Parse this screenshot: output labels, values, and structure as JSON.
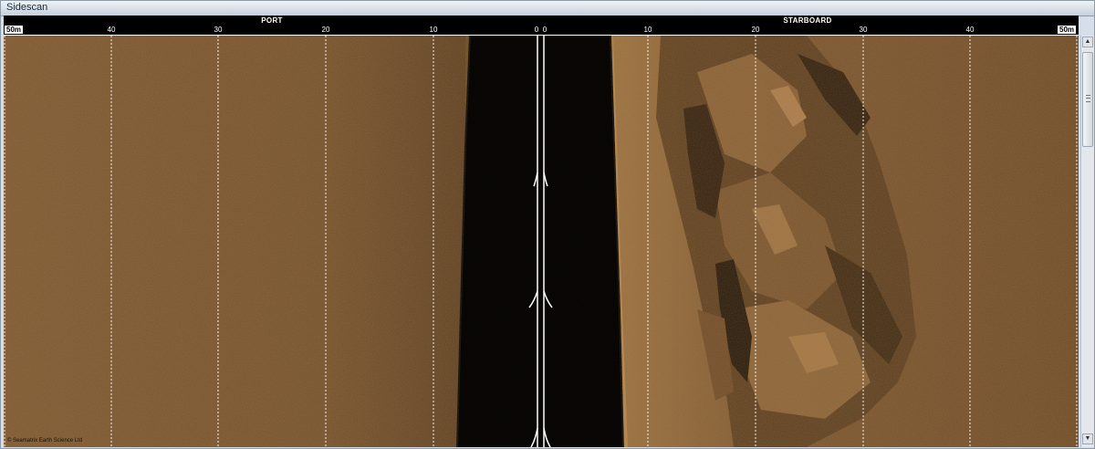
{
  "window": {
    "title": "Sidescan"
  },
  "header": {
    "port_label": "PORT",
    "starboard_label": "STARBOARD",
    "range_left": "50m",
    "range_right": "50m",
    "port_ticks": [
      "40",
      "30",
      "20",
      "10",
      "0"
    ],
    "starboard_ticks": [
      "0",
      "10",
      "20",
      "30",
      "40"
    ]
  },
  "sonar": {
    "copyright": "© Seamatrix Earth Science Ltd",
    "colors": {
      "seabed": "#7a5530",
      "water_column": "#0a0604",
      "grid": "#f2f2f2"
    }
  },
  "scrollbar": {
    "up_arrow": "▲",
    "down_arrow": "▼",
    "grip_icon": "grip-icon"
  }
}
